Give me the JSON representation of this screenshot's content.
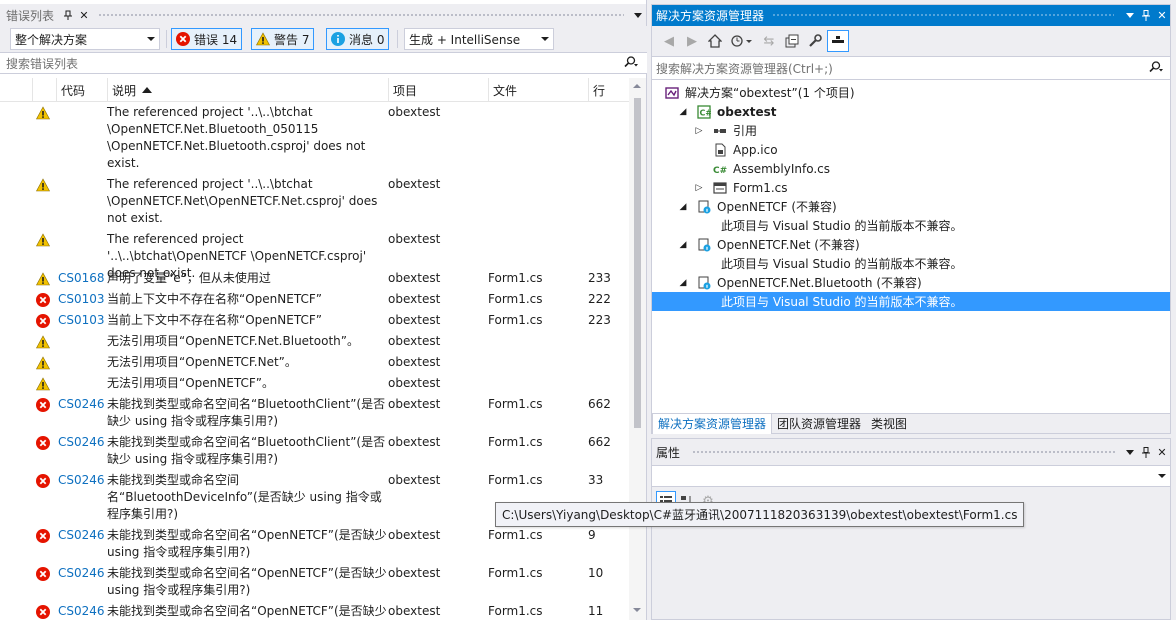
{
  "error_list": {
    "title": "错误列表",
    "pin_icon": "pin-icon",
    "close_icon": "close-icon",
    "scope": "整个解决方案",
    "errors_btn": "错误 14",
    "warnings_btn": "警告 7",
    "messages_btn": "消息 0",
    "build_filter": "生成 + IntelliSense",
    "search_placeholder": "搜索错误列表",
    "columns": {
      "code": "代码",
      "desc": "说明",
      "project": "项目",
      "file": "文件",
      "line": "行"
    },
    "rows": [
      {
        "type": "warning",
        "code": "",
        "desc": "The referenced project '..\\..\\btchat \\OpenNETCF.Net.Bluetooth_050115 \\OpenNETCF.Net.Bluetooth.csproj' does not exist.",
        "project": "obextest",
        "file": "",
        "line": ""
      },
      {
        "type": "warning",
        "code": "",
        "desc": "The referenced project '..\\..\\btchat \\OpenNETCF.Net\\OpenNETCF.Net.csproj' does not exist.",
        "project": "obextest",
        "file": "",
        "line": ""
      },
      {
        "type": "warning",
        "code": "",
        "desc": "The referenced project '..\\..\\btchat\\OpenNETCF \\OpenNETCF.csproj' does not exist.",
        "project": "obextest",
        "file": "",
        "line": ""
      },
      {
        "type": "warning",
        "code": "CS0168",
        "desc": "声明了变量“e”，但从未使用过",
        "project": "obextest",
        "file": "Form1.cs",
        "line": "233"
      },
      {
        "type": "error",
        "code": "CS0103",
        "desc": "当前上下文中不存在名称“OpenNETCF”",
        "project": "obextest",
        "file": "Form1.cs",
        "line": "222"
      },
      {
        "type": "error",
        "code": "CS0103",
        "desc": "当前上下文中不存在名称“OpenNETCF”",
        "project": "obextest",
        "file": "Form1.cs",
        "line": "223"
      },
      {
        "type": "warning",
        "code": "",
        "desc": "无法引用项目“OpenNETCF.Net.Bluetooth”。",
        "project": "obextest",
        "file": "",
        "line": ""
      },
      {
        "type": "warning",
        "code": "",
        "desc": "无法引用项目“OpenNETCF.Net”。",
        "project": "obextest",
        "file": "",
        "line": ""
      },
      {
        "type": "warning",
        "code": "",
        "desc": "无法引用项目“OpenNETCF”。",
        "project": "obextest",
        "file": "",
        "line": ""
      },
      {
        "type": "error",
        "code": "CS0246",
        "desc": "未能找到类型或命名空间名“BluetoothClient”(是否缺少 using 指令或程序集引用?)",
        "project": "obextest",
        "file": "Form1.cs",
        "line": "662"
      },
      {
        "type": "error",
        "code": "CS0246",
        "desc": "未能找到类型或命名空间名“BluetoothClient”(是否缺少 using 指令或程序集引用?)",
        "project": "obextest",
        "file": "Form1.cs",
        "line": "662"
      },
      {
        "type": "error",
        "code": "CS0246",
        "desc": "未能找到类型或命名空间名“BluetoothDeviceInfo”(是否缺少 using 指令或程序集引用?)",
        "project": "obextest",
        "file": "Form1.cs",
        "line": "33"
      },
      {
        "type": "error",
        "code": "CS0246",
        "desc": "未能找到类型或命名空间名“OpenNETCF”(是否缺少 using 指令或程序集引用?)",
        "project": "obextest",
        "file": "Form1.cs",
        "line": "9"
      },
      {
        "type": "error",
        "code": "CS0246",
        "desc": "未能找到类型或命名空间名“OpenNETCF”(是否缺少 using 指令或程序集引用?)",
        "project": "obextest",
        "file": "Form1.cs",
        "line": "10"
      },
      {
        "type": "error",
        "code": "CS0246",
        "desc": "未能找到类型或命名空间名“OpenNETCF”(是否缺少 using 指令或程序集引用?)",
        "project": "obextest",
        "file": "Form1.cs",
        "line": "11"
      }
    ]
  },
  "solution_explorer": {
    "title": "解决方案资源管理器",
    "search_placeholder": "搜索解决方案资源管理器(Ctrl+;)",
    "tree": [
      {
        "label": "解决方案“obextest”(1 个项目)",
        "icon": "solution-icon",
        "depth": 0,
        "expander": "",
        "bold": false
      },
      {
        "label": "obextest",
        "icon": "csharp-project-icon",
        "depth": 1,
        "expander": "◢",
        "bold": true
      },
      {
        "label": "引用",
        "icon": "references-icon",
        "depth": 2,
        "expander": "▷",
        "bold": false
      },
      {
        "label": "App.ico",
        "icon": "icon-file-icon",
        "depth": 2,
        "expander": "",
        "bold": false
      },
      {
        "label": "AssemblyInfo.cs",
        "icon": "csharp-file-icon",
        "depth": 2,
        "expander": "",
        "bold": false
      },
      {
        "label": "Form1.cs",
        "icon": "form-icon",
        "depth": 2,
        "expander": "▷",
        "bold": false
      },
      {
        "label": "OpenNETCF (不兼容)",
        "icon": "incompatible-project-icon",
        "depth": 1,
        "expander": "◢",
        "bold": false
      },
      {
        "label": "此项目与 Visual Studio 的当前版本不兼容。",
        "icon": "",
        "depth": 3,
        "expander": "",
        "bold": false
      },
      {
        "label": "OpenNETCF.Net (不兼容)",
        "icon": "incompatible-project-icon",
        "depth": 1,
        "expander": "◢",
        "bold": false
      },
      {
        "label": "此项目与 Visual Studio 的当前版本不兼容。",
        "icon": "",
        "depth": 3,
        "expander": "",
        "bold": false
      },
      {
        "label": "OpenNETCF.Net.Bluetooth (不兼容)",
        "icon": "incompatible-project-icon",
        "depth": 1,
        "expander": "◢",
        "bold": false
      },
      {
        "label": "此项目与 Visual Studio 的当前版本不兼容。",
        "icon": "",
        "depth": 3,
        "expander": "",
        "bold": false,
        "selected": true
      }
    ],
    "tabs": [
      "解决方案资源管理器",
      "团队资源管理器",
      "类视图"
    ]
  },
  "properties": {
    "title": "属性"
  },
  "tooltip": "C:\\Users\\Yiyang\\Desktop\\C#蓝牙通讯\\2007111820363139\\obextest\\obextest\\Form1.cs",
  "colors": {
    "accent": "#007ACC",
    "selection": "#3399FF",
    "link": "#0E70C0",
    "error": "#E51400",
    "warning": "#F2C200"
  }
}
